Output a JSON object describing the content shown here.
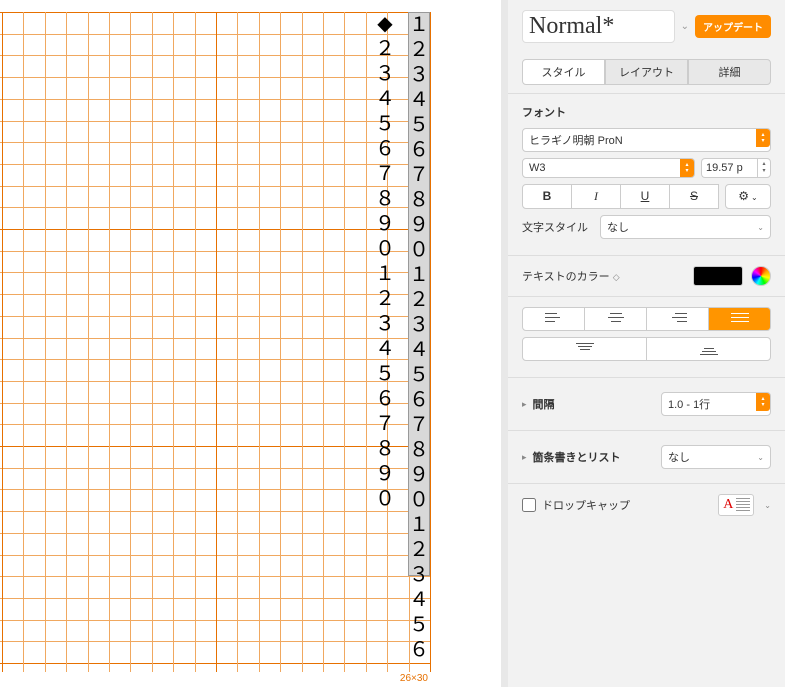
{
  "manuscript": {
    "dimensions": "26×30",
    "grid_cols": 20,
    "grid_rows": 30,
    "column1": [
      "◆",
      "２",
      "３",
      "４",
      "５",
      "６",
      "７",
      "８",
      "９",
      "０",
      "１",
      "２",
      "３",
      "４",
      "５",
      "６",
      "７",
      "８",
      "９",
      "０"
    ],
    "column2": [
      "１",
      "２",
      "３",
      "４",
      "５",
      "６",
      "７",
      "８",
      "９",
      "０",
      "１",
      "２",
      "３",
      "４",
      "５",
      "６",
      "７",
      "８",
      "９",
      "０",
      "１",
      "２",
      "３",
      "４",
      "５",
      "６"
    ]
  },
  "inspector": {
    "style_name": "Normal*",
    "update_btn": "アップデート",
    "tabs": {
      "style": "スタイル",
      "layout": "レイアウト",
      "detail": "詳細"
    },
    "font": {
      "section_label": "フォント",
      "family": "ヒラギノ明朝 ProN",
      "weight": "W3",
      "size": "19.57 p",
      "char_style_label": "文字スタイル",
      "char_style_value": "なし"
    },
    "color": {
      "label": "テキストのカラー",
      "value": "#000000"
    },
    "spacing": {
      "label": "間隔",
      "value": "1.0 - 1行"
    },
    "bullets": {
      "label": "箇条書きとリスト",
      "value": "なし"
    },
    "dropcap": {
      "label": "ドロップキャップ",
      "letter": "A"
    },
    "format_buttons": {
      "bold": "B",
      "italic": "I",
      "underline": "U",
      "strike": "S"
    }
  }
}
